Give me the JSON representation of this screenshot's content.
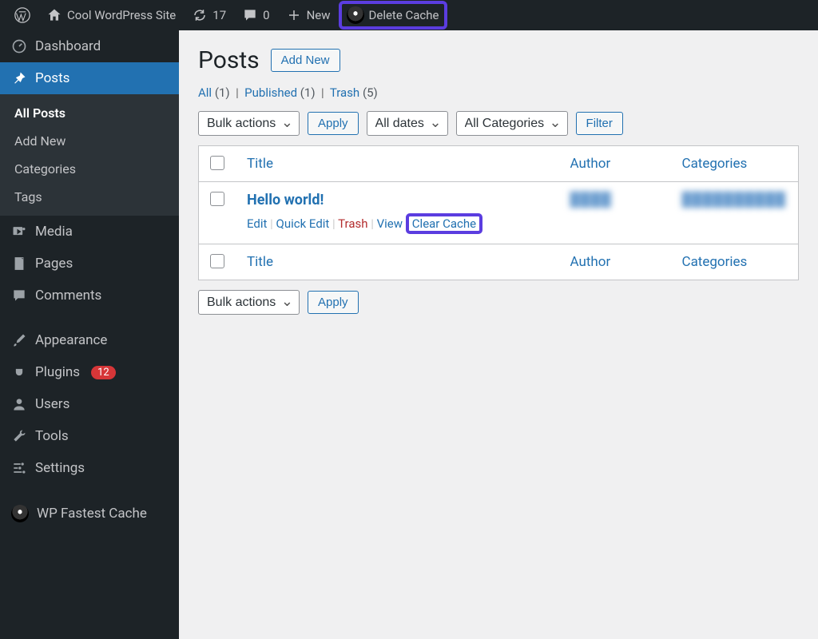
{
  "topbar": {
    "site_name": "Cool WordPress Site",
    "updates_count": "17",
    "comments_count": "0",
    "new_label": "New",
    "delete_cache_label": "Delete Cache"
  },
  "sidebar": {
    "items": [
      {
        "label": "Dashboard"
      },
      {
        "label": "Posts"
      },
      {
        "label": "Media"
      },
      {
        "label": "Pages"
      },
      {
        "label": "Comments"
      },
      {
        "label": "Appearance"
      },
      {
        "label": "Plugins",
        "badge": "12"
      },
      {
        "label": "Users"
      },
      {
        "label": "Tools"
      },
      {
        "label": "Settings"
      },
      {
        "label": "WP Fastest Cache"
      }
    ],
    "posts_sub": [
      {
        "label": "All Posts"
      },
      {
        "label": "Add New"
      },
      {
        "label": "Categories"
      },
      {
        "label": "Tags"
      }
    ]
  },
  "page": {
    "title": "Posts",
    "add_new": "Add New"
  },
  "filters": {
    "all": "All",
    "all_count": "(1)",
    "published": "Published",
    "published_count": "(1)",
    "trash": "Trash",
    "trash_count": "(5)"
  },
  "controls": {
    "bulk_actions": "Bulk actions",
    "apply": "Apply",
    "all_dates": "All dates",
    "all_categories": "All Categories",
    "filter": "Filter"
  },
  "table": {
    "headers": {
      "title": "Title",
      "author": "Author",
      "categories": "Categories"
    },
    "rows": [
      {
        "title": "Hello world!",
        "author": "████",
        "categories": "██████████",
        "actions": {
          "edit": "Edit",
          "quick_edit": "Quick Edit",
          "trash": "Trash",
          "view": "View",
          "clear_cache": "Clear Cache"
        }
      }
    ]
  }
}
